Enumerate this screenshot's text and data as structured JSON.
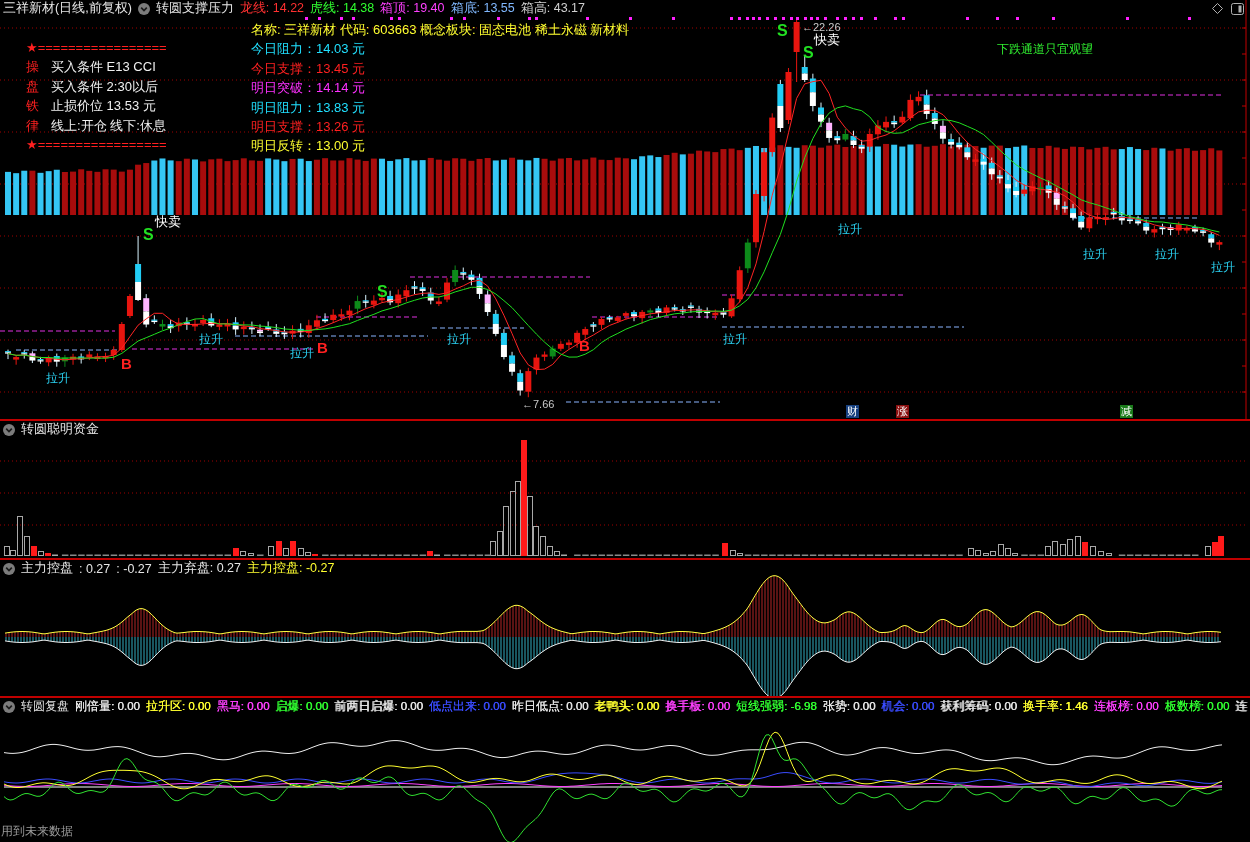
{
  "header": {
    "title": "三祥新材(日线,前复权)",
    "indicator": "转圆支撑压力",
    "readings": [
      {
        "text": "龙线: 14.22",
        "color": "#ff3030"
      },
      {
        "text": "虎线: 14.38",
        "color": "#30ff30"
      },
      {
        "text": "箱顶: 19.40",
        "color": "#ff40ff"
      },
      {
        "text": "箱底: 13.55",
        "color": "#80b8ff"
      },
      {
        "text": "箱高: 43.17",
        "color": "#d0d0d0"
      }
    ]
  },
  "trading_rules": {
    "top_rule": "★=================",
    "rows": [
      {
        "mark": "操",
        "text": "买入条件 E13 CCI"
      },
      {
        "mark": "盘",
        "text": "买入条件 2:30以后"
      },
      {
        "mark": "铁",
        "text": "止损价位 13.53 元"
      },
      {
        "mark": "律",
        "text": "线上:开仓 线下:休息"
      }
    ],
    "bottom_rule": "★================="
  },
  "stock_info": {
    "name_line": "名称: 三祥新材 代码: 603663 概念板块: 固态电池 稀土永磁 新材料",
    "levels": [
      {
        "text": "今日阻力：14.03 元",
        "color": "#20e0ff"
      },
      {
        "text": "今日支撑：13.45 元",
        "color": "#ff2020"
      },
      {
        "text": "明日突破：14.14 元",
        "color": "#ff30ff"
      },
      {
        "text": "明日阻力：13.83 元",
        "color": "#20e0ff"
      },
      {
        "text": "明日支撑：13.26 元",
        "color": "#ff2020"
      },
      {
        "text": "明日反转：13.00 元",
        "color": "#ffff30"
      }
    ]
  },
  "chart": {
    "signals": [
      {
        "kind": "rise",
        "text": "拉升"
      },
      {
        "kind": "buy",
        "text": "B"
      },
      {
        "kind": "quick_sell",
        "text": "快卖"
      },
      {
        "kind": "sell",
        "text": "S"
      },
      {
        "kind": "rise",
        "text": "拉升"
      },
      {
        "kind": "rise",
        "text": "拉升"
      },
      {
        "kind": "buy",
        "text": "B"
      },
      {
        "kind": "sell",
        "text": "S"
      },
      {
        "kind": "rise",
        "text": "拉升"
      },
      {
        "kind": "price_note",
        "text": "←7.66"
      },
      {
        "kind": "buy",
        "text": "B"
      },
      {
        "kind": "rise",
        "text": "拉升"
      },
      {
        "kind": "sell",
        "text": "S"
      },
      {
        "kind": "price_note",
        "text": "←22.26"
      },
      {
        "kind": "quick_sell",
        "text": "快卖"
      },
      {
        "kind": "sell",
        "text": "S"
      },
      {
        "kind": "rise",
        "text": "拉升"
      },
      {
        "kind": "rise",
        "text": "拉升"
      },
      {
        "kind": "rise",
        "text": "拉升"
      },
      {
        "kind": "rise",
        "text": "拉升"
      }
    ],
    "trend_note": "下跌通道只宜观望",
    "event_tags": [
      {
        "text": "财",
        "color": "#17407f"
      },
      {
        "text": "涨",
        "color": "#8a1010"
      },
      {
        "text": "减",
        "color": "#1a7a1a"
      }
    ]
  },
  "smart_money": {
    "title": "转圆聪明资金"
  },
  "control_panel": {
    "title": "主力控盘",
    "readings": [
      {
        "text": ": 0.27",
        "color": "#e6e6e6"
      },
      {
        "text": ": -0.27",
        "color": "#e6e6e6"
      },
      {
        "text": "主力弃盘: 0.27",
        "color": "#e6e6e6"
      },
      {
        "text": "主力控盘: -0.27",
        "color": "#ffff30"
      }
    ]
  },
  "review_panel": {
    "title": "转圆复盘",
    "readings": [
      {
        "text": "刚倍量: 0.00",
        "color": "#e6e6e6"
      },
      {
        "text": "拉升区: 0.00",
        "color": "#ffff30"
      },
      {
        "text": "黑马: 0.00",
        "color": "#ff40ff"
      },
      {
        "text": "启爆: 0.00",
        "color": "#30ff30"
      },
      {
        "text": "前两日启爆: 0.00",
        "color": "#e6e6e6"
      },
      {
        "text": "低点出来: 0.00",
        "color": "#3a4cff"
      },
      {
        "text": "昨日低点: 0.00",
        "color": "#e6e6e6"
      },
      {
        "text": "老鸭头: 0.00",
        "color": "#ffff30"
      },
      {
        "text": "换手板: 0.00",
        "color": "#ff40ff"
      },
      {
        "text": "短线强弱: -6.98",
        "color": "#30ff30"
      },
      {
        "text": "张势: 0.00",
        "color": "#e6e6e6"
      },
      {
        "text": "机会: 0.00",
        "color": "#3a4cff"
      },
      {
        "text": "获利筹码: 0.00",
        "color": "#e6e6e6"
      },
      {
        "text": "换手率: 1.46",
        "color": "#ffff30"
      },
      {
        "text": "连板榜: 0.00",
        "color": "#ff40ff"
      },
      {
        "text": "板数榜: 0.00",
        "color": "#30ff30"
      },
      {
        "text": "连",
        "color": "#e6e6e6"
      }
    ],
    "footer": "用到未来数据"
  }
}
